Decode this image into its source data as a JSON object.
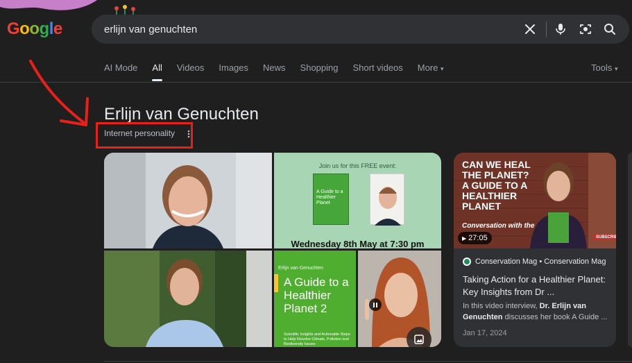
{
  "logo": {
    "parts": [
      "G",
      "o",
      "o",
      "g",
      "l",
      "e"
    ]
  },
  "search": {
    "query": "erlijn van genuchten"
  },
  "tabs": [
    {
      "label": "AI Mode"
    },
    {
      "label": "All"
    },
    {
      "label": "Videos"
    },
    {
      "label": "Images"
    },
    {
      "label": "News"
    },
    {
      "label": "Shopping"
    },
    {
      "label": "Short videos"
    },
    {
      "label": "More"
    }
  ],
  "active_tab": "All",
  "tools_label": "Tools",
  "entity": {
    "title": "Erlijn van Genuchten",
    "subtitle": "Internet personality"
  },
  "mosaic": {
    "event_tile": {
      "line1": "Join us for this FREE event:",
      "book_title": "A Guide to a Healthier Planet",
      "date_line": "Wednesday 8th May at 7:30 pm"
    },
    "book_tile": {
      "author": "Erlijn van Genuchten",
      "title": "A Guide to a Healthier Planet 2",
      "subtitle": "Scientific Insights and Actionable Steps to Help Resolve Climate, Pollution and Biodiversity Issues"
    }
  },
  "video": {
    "thumb_text": "Can we heal the planet? A guide to a healthier planet",
    "thumb_sub": "Conversation with the",
    "duration": "27:05",
    "source": "Conservation Mag • Conservation Mag",
    "title": "Taking Action for a Healthier Planet: Key Insights from Dr ...",
    "snippet_pre": "In this video interview, ",
    "snippet_bold": "Dr. Erlijn van Genuchten",
    "snippet_post": " discusses her book A Guide ...",
    "date": "Jan 17, 2024",
    "subscribe": "SUBSCRIBE"
  },
  "colors": {
    "background": "#1f1f1f",
    "searchbox": "#303134",
    "annotation_red": "#e8201a"
  }
}
